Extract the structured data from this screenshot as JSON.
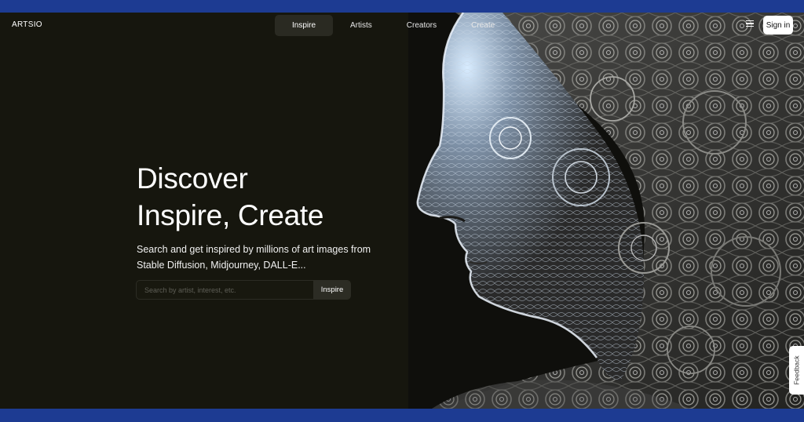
{
  "nav": {
    "logo": "ARTSIO",
    "links": [
      {
        "label": "Inspire",
        "active": true
      },
      {
        "label": "Artists",
        "active": false
      },
      {
        "label": "Creators",
        "active": false
      },
      {
        "label": "Create",
        "active": false
      }
    ],
    "menu_icon": "hamburger-menu-icon",
    "signin_label": "Sign in"
  },
  "hero": {
    "headline_line1": "Discover",
    "headline_line2": "Inspire, Create",
    "subline": "Search and get inspired by millions of art images from Stable Diffusion, Midjourney, DALL-E...",
    "search": {
      "placeholder": "Search by artist, interest, etc.",
      "value": "",
      "button_label": "Inspire"
    },
    "image": "ai-generated-wire-face-portrait"
  },
  "feedback_label": "Feedback",
  "colors": {
    "background": "#16160e",
    "frame": "#1d3b92",
    "accent_surface": "#2c2c24",
    "text": "#ffffff"
  }
}
